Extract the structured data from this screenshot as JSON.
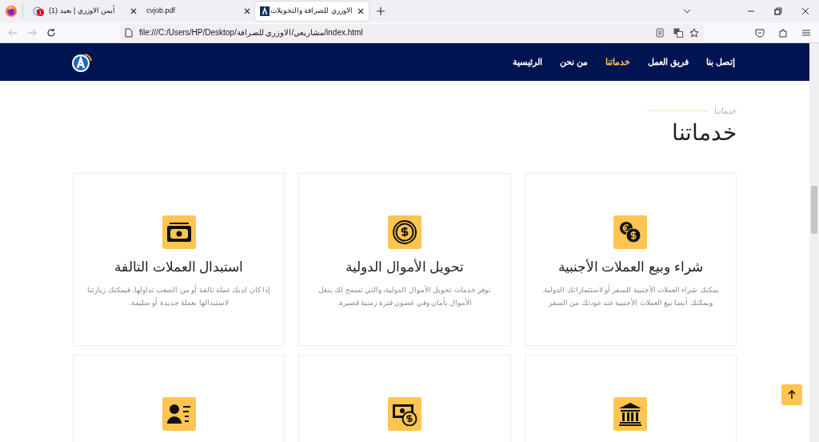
{
  "browser": {
    "tabs": [
      {
        "title": "الاوزري للصرافة والتحويلات",
        "selected": true
      },
      {
        "title": "cvjob.pdf",
        "selected": false
      },
      {
        "title": "أيمن الاوزري | بعيد (1)",
        "selected": false,
        "badge": "1"
      }
    ],
    "address": "file:///C:/Users/HP/Desktop/مشاريعي/الاوزري للصرافة/index.html"
  },
  "nav": {
    "links": [
      {
        "label": "إتصل بنا",
        "selected": false
      },
      {
        "label": "فريق العمل",
        "selected": false
      },
      {
        "label": "خدماتنا",
        "selected": true
      },
      {
        "label": "من نحن",
        "selected": false
      },
      {
        "label": "الرئيسية",
        "selected": false
      }
    ]
  },
  "section": {
    "eyebrow": "خدماتنا",
    "title": "خدماتنا"
  },
  "services": [
    {
      "title": "شراء وبيع العملات الأجنبية",
      "description": "يمكنك شراء العملات الأجنبية للسفر أو لاستثماراتك الدولية. ويمكنك أيضا بيع العملات الأجنبية عند عودتك من السفر"
    },
    {
      "title": "تحويل الأموال الدولية",
      "description": "نوفر خدمات تحويل الأموال الدولية، والتي تسمح لك بنقل الأموال بأمان وفي غضون فترة زمنية قصيرة."
    },
    {
      "title": "استبدال العملات التالفة",
      "description": "إذا كان لديك عملة تالفة أو من الصعب تداولها، فيمكنك زيارتنا لاستبدالها بعملة جديدة أو سليمة."
    },
    {
      "kind": "cut"
    },
    {
      "kind": "cut"
    },
    {
      "kind": "cut"
    }
  ]
}
